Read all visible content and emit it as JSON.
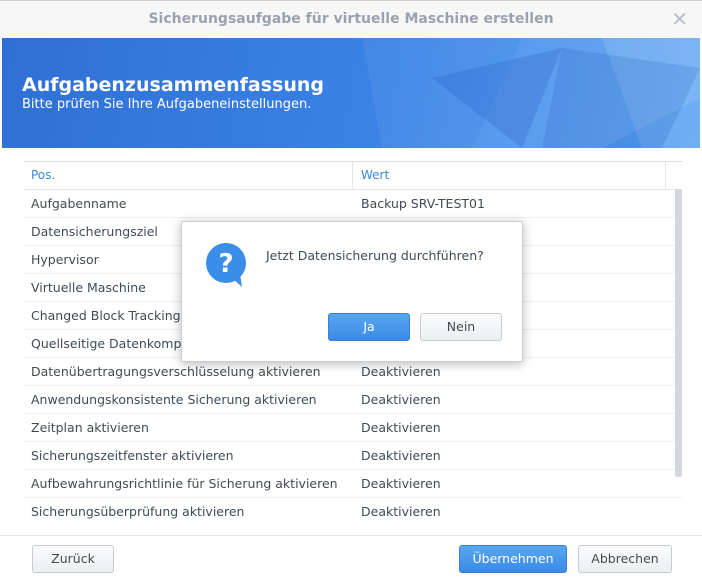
{
  "window": {
    "title": "Sicherungsaufgabe für virtuelle Maschine erstellen",
    "close_symbol": "✕"
  },
  "banner": {
    "heading": "Aufgabenzusammenfassung",
    "subheading": "Bitte prüfen Sie Ihre Aufgabeneinstellungen."
  },
  "grid": {
    "columns": [
      "Pos.",
      "Wert"
    ],
    "rows": [
      {
        "pos": "Aufgabenname",
        "wert": "Backup SRV-TEST01"
      },
      {
        "pos": "Datensicherungsziel",
        "wert": ""
      },
      {
        "pos": "Hypervisor",
        "wert": ""
      },
      {
        "pos": "Virtuelle Maschine",
        "wert": ""
      },
      {
        "pos": "Changed Block Tracking a",
        "wert": ""
      },
      {
        "pos": "Quellseitige Datenkompri",
        "wert": ""
      },
      {
        "pos": "Datenübertragungsverschlüsselung aktivieren",
        "wert": "Deaktivieren"
      },
      {
        "pos": "Anwendungskonsistente Sicherung aktivieren",
        "wert": "Deaktivieren"
      },
      {
        "pos": "Zeitplan aktivieren",
        "wert": "Deaktivieren"
      },
      {
        "pos": "Sicherungszeitfenster aktivieren",
        "wert": "Deaktivieren"
      },
      {
        "pos": "Aufbewahrungsrichtlinie für Sicherung aktivieren",
        "wert": "Deaktivieren"
      },
      {
        "pos": "Sicherungsüberprüfung aktivieren",
        "wert": "Deaktivieren"
      },
      {
        "pos": "",
        "wert": ""
      }
    ]
  },
  "footer": {
    "back_label": "Zurück",
    "apply_label": "Übernehmen",
    "cancel_label": "Abbrechen"
  },
  "dialog": {
    "icon": "question-icon",
    "icon_glyph": "?",
    "message": "Jetzt Datensicherung durchführen?",
    "yes_label": "Ja",
    "no_label": "Nein"
  },
  "colors": {
    "accent": "#3a88d6",
    "banner": "#3b83e6"
  }
}
